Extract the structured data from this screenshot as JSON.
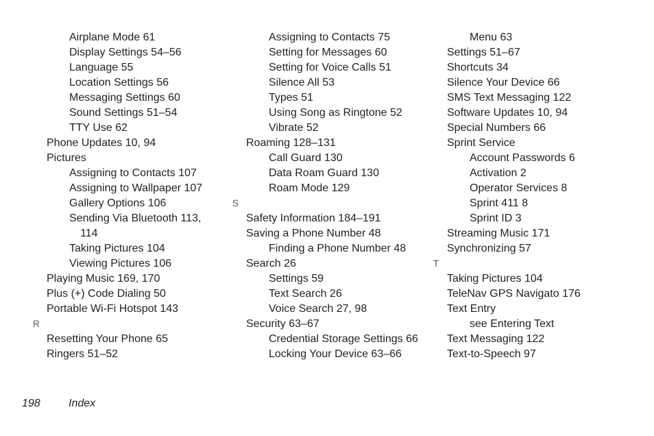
{
  "document": {
    "type": "index-page",
    "footer": {
      "page_number": "198",
      "label": "Index"
    }
  },
  "columns": [
    {
      "id": "column-1",
      "blocks": [
        {
          "kind": "sub",
          "text": "Airplane Mode 61"
        },
        {
          "kind": "sub",
          "text": "Display Settings 54–56"
        },
        {
          "kind": "sub",
          "text": "Language 55"
        },
        {
          "kind": "sub",
          "text": "Location Settings 56"
        },
        {
          "kind": "sub",
          "text": "Messaging Settings 60"
        },
        {
          "kind": "sub",
          "text": "Sound Settings 51–54"
        },
        {
          "kind": "sub",
          "text": "TTY Use 62"
        },
        {
          "kind": "main",
          "text": "Phone Updates 10, 94"
        },
        {
          "kind": "main",
          "text": "Pictures"
        },
        {
          "kind": "sub",
          "text": "Assigning to Contacts 107"
        },
        {
          "kind": "sub",
          "text": "Assigning to Wallpaper 107"
        },
        {
          "kind": "sub",
          "text": "Gallery Options 106"
        },
        {
          "kind": "sub",
          "text": "Sending Via Bluetooth 113, 114"
        },
        {
          "kind": "sub",
          "text": "Taking Pictures 104"
        },
        {
          "kind": "sub",
          "text": "Viewing Pictures 106"
        },
        {
          "kind": "main",
          "text": "Playing Music 169, 170"
        },
        {
          "kind": "main",
          "text": "Plus (+) Code Dialing 50"
        },
        {
          "kind": "main",
          "text": "Portable Wi-Fi Hotspot 143"
        },
        {
          "kind": "letter",
          "text": "R"
        },
        {
          "kind": "main",
          "text": "Resetting Your Phone 65"
        },
        {
          "kind": "main",
          "text": "Ringers 51–52"
        }
      ]
    },
    {
      "id": "column-2",
      "blocks": [
        {
          "kind": "sub",
          "text": "Assigning to Contacts 75"
        },
        {
          "kind": "sub",
          "text": "Setting for Messages 60"
        },
        {
          "kind": "sub",
          "text": "Setting for Voice Calls 51"
        },
        {
          "kind": "sub",
          "text": "Silence All 53"
        },
        {
          "kind": "sub",
          "text": "Types 51"
        },
        {
          "kind": "sub",
          "text": "Using Song as Ringtone 52"
        },
        {
          "kind": "sub",
          "text": "Vibrate 52"
        },
        {
          "kind": "main",
          "text": "Roaming 128–131"
        },
        {
          "kind": "sub",
          "text": "Call Guard 130"
        },
        {
          "kind": "sub",
          "text": "Data Roam Guard 130"
        },
        {
          "kind": "sub",
          "text": "Roam Mode 129"
        },
        {
          "kind": "letter",
          "text": "S"
        },
        {
          "kind": "main",
          "text": "Safety Information 184–191"
        },
        {
          "kind": "main",
          "text": "Saving a Phone Number 48"
        },
        {
          "kind": "sub",
          "text": "Finding a Phone Number 48"
        },
        {
          "kind": "main",
          "text": "Search 26"
        },
        {
          "kind": "sub",
          "text": "Settings 59"
        },
        {
          "kind": "sub",
          "text": "Text Search 26"
        },
        {
          "kind": "sub",
          "text": "Voice Search 27, 98"
        },
        {
          "kind": "main",
          "text": "Security 63–67"
        },
        {
          "kind": "sub",
          "text": "Credential Storage Settings 66"
        },
        {
          "kind": "sub",
          "text": "Locking Your Device 63–66"
        }
      ]
    },
    {
      "id": "column-3",
      "blocks": [
        {
          "kind": "sub",
          "text": "Menu 63"
        },
        {
          "kind": "main",
          "text": "Settings 51–67"
        },
        {
          "kind": "main",
          "text": "Shortcuts 34"
        },
        {
          "kind": "main",
          "text": "Silence Your Device 66"
        },
        {
          "kind": "main",
          "text": "SMS Text Messaging 122"
        },
        {
          "kind": "main",
          "text": "Software Updates 10, 94"
        },
        {
          "kind": "main",
          "text": "Special Numbers 66"
        },
        {
          "kind": "main",
          "text": "Sprint Service"
        },
        {
          "kind": "sub",
          "text": "Account Passwords 6"
        },
        {
          "kind": "sub",
          "text": "Activation 2"
        },
        {
          "kind": "sub",
          "text": "Operator Services 8"
        },
        {
          "kind": "sub",
          "text": "Sprint 411 8"
        },
        {
          "kind": "sub",
          "text": "Sprint ID 3"
        },
        {
          "kind": "main",
          "text": "Streaming Music 171"
        },
        {
          "kind": "main",
          "text": "Synchronizing 57"
        },
        {
          "kind": "letter",
          "text": "T"
        },
        {
          "kind": "main",
          "text": "Taking Pictures 104"
        },
        {
          "kind": "main",
          "text": "TeleNav GPS Navigato 176"
        },
        {
          "kind": "main",
          "text": "Text Entry"
        },
        {
          "kind": "sub",
          "text": "see Entering Text"
        },
        {
          "kind": "main",
          "text": "Text Messaging 122"
        },
        {
          "kind": "main",
          "text": "Text-to-Speech 97"
        }
      ]
    }
  ]
}
